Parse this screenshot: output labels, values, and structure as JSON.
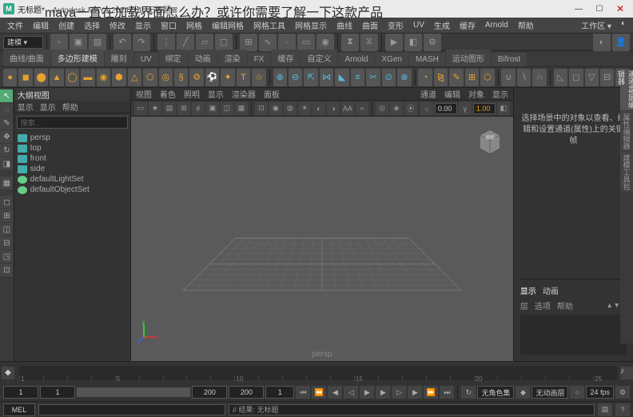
{
  "overlay_title": "maya一直在加载界面怎么办？或许你需要了解一下这款产品",
  "titlebar": {
    "doc": "无标题*",
    "app": "- Autodesk MAYA 2024.0.1: 无标题"
  },
  "menu": [
    "文件",
    "编辑",
    "创建",
    "选择",
    "修改",
    "显示",
    "窗口",
    "网格",
    "编辑网格",
    "网格工具",
    "网格显示",
    "曲线",
    "曲面",
    "变形",
    "UV",
    "生成",
    "缓存",
    "Arnold",
    "帮助"
  ],
  "menu_right": [
    "工作区 ▾",
    "◐"
  ],
  "modeling_dd": "建模 ▾",
  "tabs_row1": [
    "曲线/曲面",
    "多边形建模",
    "UV",
    "绑定",
    "动画",
    "FX",
    "缓存",
    "自定义",
    "Arnold",
    "XGen",
    "MASH",
    "运动图形",
    "Bifrost"
  ],
  "tab1_selected": 1,
  "outliner": {
    "title": "大纲视图",
    "menu": [
      "显示",
      "显示",
      "帮助"
    ],
    "search_ph": "搜索...",
    "items": [
      {
        "icon": "cam",
        "name": "persp"
      },
      {
        "icon": "cam",
        "name": "top"
      },
      {
        "icon": "cam",
        "name": "front"
      },
      {
        "icon": "cam",
        "name": "side"
      },
      {
        "icon": "set",
        "name": "defaultLightSet"
      },
      {
        "icon": "set",
        "name": "defaultObjectSet"
      }
    ]
  },
  "viewport": {
    "menu": [
      "视图",
      "着色",
      "照明",
      "显示",
      "渲染器",
      "面板"
    ],
    "field1": "0.00",
    "field2": "1.00",
    "camera": "persp",
    "rmenu": [
      "通道",
      "编辑",
      "对象",
      "显示"
    ]
  },
  "channelbox": {
    "hint": "选择场景中的对象以查看、编辑和设置通道(属性)上的关键帧",
    "sec_tabs": [
      "显示",
      "动画"
    ],
    "sec_row": [
      "层",
      "选项",
      "帮助"
    ]
  },
  "rtabs": [
    "通道盒/层编辑器",
    "属性编辑器",
    "建模工具包"
  ],
  "timeline": {
    "ticks": [
      "1",
      "",
      "",
      "",
      "5",
      "",
      "",
      "",
      "",
      "10",
      "",
      "",
      "",
      "",
      "15",
      "",
      "",
      "",
      "",
      "20",
      "",
      "",
      "",
      "",
      "25"
    ]
  },
  "range": {
    "start_out": "1",
    "start_in": "1",
    "end_in": "200",
    "end_out": "200",
    "cur": "1",
    "nochar": "无角色集",
    "noanim": "无动画层",
    "fps": "24 fps"
  },
  "cmd": {
    "mel": "MEL",
    "result_ph": "// 结果: 无标题"
  }
}
